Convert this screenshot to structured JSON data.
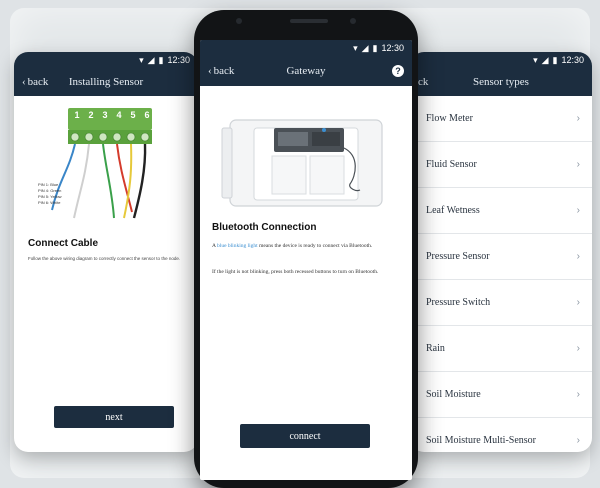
{
  "status": {
    "time": "12:30"
  },
  "left_screen": {
    "back_label": "back",
    "title": "Installing Sensor",
    "terminals": [
      "1",
      "2",
      "3",
      "4",
      "5",
      "6"
    ],
    "pins": [
      "PIN 1: Blue",
      "PIN 4: Green",
      "PIN 5: Yellow",
      "PIN 6: White"
    ],
    "heading": "Connect Cable",
    "description": "Follow the above wiring diagram to correctly connect the sensor to the node.",
    "next_label": "next"
  },
  "center_screen": {
    "back_label": "back",
    "title": "Gateway",
    "help_label": "?",
    "heading": "Bluetooth Connection",
    "para1_prefix": "A ",
    "para1_link": "blue blinking light",
    "para1_suffix": " means the device is ready to connect via Bluetooth.",
    "para2": "If the light is not blinking, press both recessed buttons to turn on Bluetooth.",
    "connect_label": "connect"
  },
  "right_screen": {
    "back_label": "ck",
    "title": "Sensor types",
    "items": [
      "Flow Meter",
      "Fluid Sensor",
      "Leaf Wetness",
      "Pressure Sensor",
      "Pressure Switch",
      "Rain",
      "Soil Moisture",
      "Soil Moisture Multi-Sensor"
    ],
    "chevron": "›"
  },
  "colors": {
    "navbar": "#1c2d3f",
    "link": "#3b8fd1",
    "terminal_green": "#6cb04a"
  }
}
